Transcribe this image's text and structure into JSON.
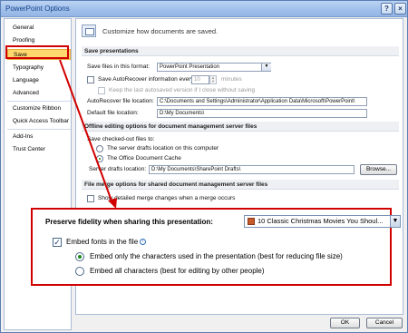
{
  "window": {
    "title": "PowerPoint Options",
    "help": "?",
    "close": "×"
  },
  "sidebar": {
    "items": [
      {
        "label": "General"
      },
      {
        "label": "Proofing"
      },
      {
        "label": "Save"
      },
      {
        "label": "Typography"
      },
      {
        "label": "Language"
      },
      {
        "label": "Advanced"
      },
      {
        "label": "Customize Ribbon"
      },
      {
        "label": "Quick Access Toolbar"
      },
      {
        "label": "Add-Ins"
      },
      {
        "label": "Trust Center"
      }
    ]
  },
  "header": {
    "text": "Customize how documents are saved."
  },
  "save_presentations": {
    "heading": "Save presentations",
    "format_label": "Save files in this format:",
    "format_value": "PowerPoint Presentation",
    "autorecover_label": "Save AutoRecover information every",
    "autorecover_minutes": "10",
    "minutes_label": "minutes",
    "keep_last_label": "Keep the last autosaved version if I close without saving",
    "autorecover_location_label": "AutoRecover file location:",
    "autorecover_location_value": "C:\\Documents and Settings\\Administrator\\Application Data\\Microsoft\\PowerPoint\\",
    "default_location_label": "Default file location:",
    "default_location_value": "D:\\My Documents\\"
  },
  "offline_editing": {
    "heading": "Offline editing options for document management server files",
    "save_checked_out_label": "Save checked-out files to:",
    "option_server_drafts": "The server drafts location on this computer",
    "option_office_cache": "The Office Document Cache",
    "server_drafts_label": "Server drafts location:",
    "server_drafts_value": "D:\\My Documents\\SharePoint Drafts\\",
    "browse_label": "Browse..."
  },
  "file_merge": {
    "heading": "File merge options for shared document management server files",
    "show_merge_label": "Show detailed merge changes when a merge occurs"
  },
  "fidelity": {
    "label": "Preserve fidelity when sharing this presentation:",
    "selected_file": "10 Classic Christmas Movies You Shoul...",
    "embed_fonts_label": "Embed fonts in the file",
    "info_glyph": "i",
    "embed_only_label": "Embed only the characters used in the presentation (best for reducing file size)",
    "embed_all_label": "Embed all characters (best for editing by other people)"
  },
  "footer": {
    "ok_label": "OK",
    "cancel_label": "Cancel"
  },
  "colors": {
    "highlight": "#d10000",
    "active_item": "#ffd86e",
    "title_bar": "#a3c2ec"
  }
}
